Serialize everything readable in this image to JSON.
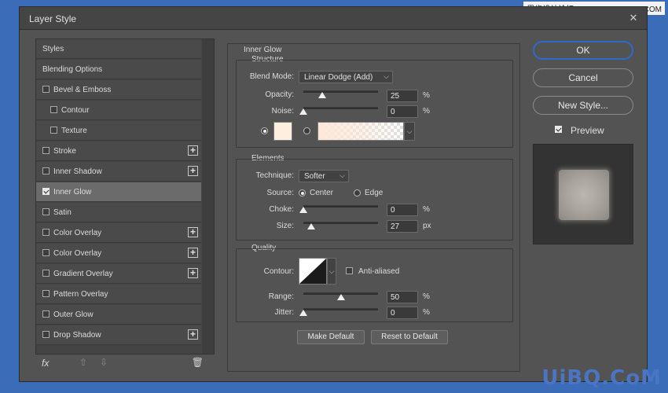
{
  "window": {
    "title": "Layer Style"
  },
  "watermark_top": "思缘设计论坛 WWW.MISSYUAN.COM",
  "watermark_bottom": "UiBQ.CoM",
  "sidebar": {
    "items": [
      {
        "label": "Styles",
        "checkbox": false,
        "checked": false,
        "plus": false,
        "indent": 0,
        "selected": false
      },
      {
        "label": "Blending Options",
        "checkbox": false,
        "checked": false,
        "plus": false,
        "indent": 0,
        "selected": false
      },
      {
        "label": "Bevel & Emboss",
        "checkbox": true,
        "checked": false,
        "plus": false,
        "indent": 0,
        "selected": false
      },
      {
        "label": "Contour",
        "checkbox": true,
        "checked": false,
        "plus": false,
        "indent": 1,
        "selected": false
      },
      {
        "label": "Texture",
        "checkbox": true,
        "checked": false,
        "plus": false,
        "indent": 1,
        "selected": false
      },
      {
        "label": "Stroke",
        "checkbox": true,
        "checked": false,
        "plus": true,
        "indent": 0,
        "selected": false
      },
      {
        "label": "Inner Shadow",
        "checkbox": true,
        "checked": false,
        "plus": true,
        "indent": 0,
        "selected": false
      },
      {
        "label": "Inner Glow",
        "checkbox": true,
        "checked": true,
        "plus": false,
        "indent": 0,
        "selected": true
      },
      {
        "label": "Satin",
        "checkbox": true,
        "checked": false,
        "plus": false,
        "indent": 0,
        "selected": false
      },
      {
        "label": "Color Overlay",
        "checkbox": true,
        "checked": false,
        "plus": true,
        "indent": 0,
        "selected": false
      },
      {
        "label": "Color Overlay",
        "checkbox": true,
        "checked": false,
        "plus": true,
        "indent": 0,
        "selected": false
      },
      {
        "label": "Gradient Overlay",
        "checkbox": true,
        "checked": false,
        "plus": true,
        "indent": 0,
        "selected": false
      },
      {
        "label": "Pattern Overlay",
        "checkbox": true,
        "checked": false,
        "plus": false,
        "indent": 0,
        "selected": false
      },
      {
        "label": "Outer Glow",
        "checkbox": true,
        "checked": false,
        "plus": false,
        "indent": 0,
        "selected": false
      },
      {
        "label": "Drop Shadow",
        "checkbox": true,
        "checked": false,
        "plus": true,
        "indent": 0,
        "selected": false
      }
    ],
    "bottom": {
      "fx_label": "fx"
    }
  },
  "inner_glow": {
    "title": "Inner Glow",
    "structure": {
      "title": "Structure",
      "blend_mode_label": "Blend Mode:",
      "blend_mode_value": "Linear Dodge (Add)",
      "opacity_label": "Opacity:",
      "opacity_value": "25",
      "opacity_percent": 25,
      "opacity_unit": "%",
      "noise_label": "Noise:",
      "noise_value": "0",
      "noise_percent": 0,
      "noise_unit": "%",
      "glow_color": "#fdeee0"
    },
    "elements": {
      "title": "Elements",
      "technique_label": "Technique:",
      "technique_value": "Softer",
      "source_label": "Source:",
      "source_center": "Center",
      "source_edge": "Edge",
      "choke_label": "Choke:",
      "choke_value": "0",
      "choke_percent": 0,
      "choke_unit": "%",
      "size_label": "Size:",
      "size_value": "27",
      "size_fraction": 0.11,
      "size_unit": "px"
    },
    "quality": {
      "title": "Quality",
      "contour_label": "Contour:",
      "anti_aliased_label": "Anti-aliased",
      "range_label": "Range:",
      "range_value": "50",
      "range_percent": 50,
      "range_unit": "%",
      "jitter_label": "Jitter:",
      "jitter_value": "0",
      "jitter_percent": 0,
      "jitter_unit": "%"
    },
    "make_default_label": "Make Default",
    "reset_default_label": "Reset to Default"
  },
  "actions": {
    "ok_label": "OK",
    "cancel_label": "Cancel",
    "new_style_label": "New Style...",
    "preview_label": "Preview"
  },
  "colors": {
    "accent": "#2d6bcf",
    "selected_row": "#6b6b6b",
    "frame": "#3b6cb8"
  }
}
